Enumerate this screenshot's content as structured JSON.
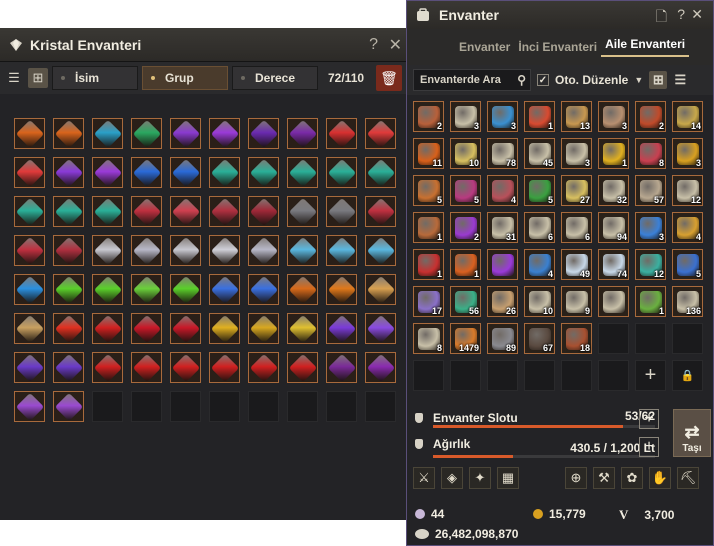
{
  "kristal": {
    "title": "Kristal Envanteri",
    "help": "?",
    "close": "✕",
    "sort_name": "İsim",
    "sort_group": "Grup",
    "sort_grade": "Derece",
    "count": "72/110",
    "trash": "🗑",
    "view_list": "☰",
    "view_grid": "⊞",
    "filled": 72,
    "total": 80,
    "gem_colors": [
      "#d9641c",
      "#d9641c",
      "#2aa0c8",
      "#2aa860",
      "#8a3ad0",
      "#9a3ad8",
      "#6a2ab0",
      "#7a2aa8",
      "#d83030",
      "#e03a3a",
      "#e03a3a",
      "#8a3ad8",
      "#9a3ad8",
      "#2a6ad8",
      "#2a6ad8",
      "#2ab098",
      "#2ab098",
      "#2ab098",
      "#2ab098",
      "#2ab098",
      "#2ab098",
      "#2ab098",
      "#2ab098",
      "#c03040",
      "#d04050",
      "#b03040",
      "#a02838",
      "#7a7a80",
      "#7a7a80",
      "#c03040",
      "#c03040",
      "#b03040",
      "#c8c8d0",
      "#b8b8c8",
      "#c8c8d0",
      "#d0d0d8",
      "#b8b8c8",
      "#5ab8e0",
      "#5ab8e0",
      "#5ab8e0",
      "#2a90e0",
      "#5ad02a",
      "#5ad02a",
      "#6ad03a",
      "#5ad02a",
      "#3a70e0",
      "#3a70e0",
      "#d86a1a",
      "#e0781a",
      "#d8a050",
      "#c8a060",
      "#e03020",
      "#d02020",
      "#c81828",
      "#c81828",
      "#e0b020",
      "#d8a820",
      "#e0c030",
      "#7a3ad8",
      "#8a4ae0",
      "#6a3ac8",
      "#6a3ac8",
      "#d02020",
      "#d02020",
      "#d02020",
      "#d02020",
      "#d02020",
      "#d02020",
      "#7a2a98",
      "#8a2ab0",
      "#9a4ad0",
      "#9a4ad0"
    ]
  },
  "envanter": {
    "title": "Envanter",
    "tabs": [
      "Envanter",
      "İnci Envanteri",
      "Aile Envanteri"
    ],
    "active_tab": "Aile Envanteri",
    "search_label": "Envanterde Ara",
    "auto_sort": "Oto. Düzenle",
    "items": [
      {
        "c": "#b8603a",
        "q": "2"
      },
      {
        "c": "#c8c0a8",
        "q": "3"
      },
      {
        "c": "#3a90d0",
        "q": "3"
      },
      {
        "c": "#d84a30",
        "q": "1"
      },
      {
        "c": "#c89850",
        "q": "13"
      },
      {
        "c": "#b89070",
        "q": "3"
      },
      {
        "c": "#c04a2a",
        "q": "2"
      },
      {
        "c": "#c8a84a",
        "q": "14"
      },
      {
        "c": "#d8601a",
        "q": "11"
      },
      {
        "c": "#d8c060",
        "q": "10"
      },
      {
        "c": "#c8c0a8",
        "q": "78"
      },
      {
        "c": "#c8c0a8",
        "q": "45"
      },
      {
        "c": "#c8c0a8",
        "q": "3"
      },
      {
        "c": "#e0b020",
        "q": "1"
      },
      {
        "c": "#c84050",
        "q": "8"
      },
      {
        "c": "#d8a020",
        "q": "3"
      },
      {
        "c": "#c87030",
        "q": "5"
      },
      {
        "c": "#b83a80",
        "q": "5"
      },
      {
        "c": "#b8505a",
        "q": "4"
      },
      {
        "c": "#3aa040",
        "q": "5"
      },
      {
        "c": "#d8c060",
        "q": "27"
      },
      {
        "c": "#c8c0a8",
        "q": "32"
      },
      {
        "c": "#b8a890",
        "q": "57"
      },
      {
        "c": "#c8c0a8",
        "q": "12"
      },
      {
        "c": "#b86a3a",
        "q": "1"
      },
      {
        "c": "#9a3ad0",
        "q": "2"
      },
      {
        "c": "#c8c0a8",
        "q": "31"
      },
      {
        "c": "#c8c0a8",
        "q": "6"
      },
      {
        "c": "#c8c0a8",
        "q": "6"
      },
      {
        "c": "#c8c0a8",
        "q": "94"
      },
      {
        "c": "#3a80d8",
        "q": "3"
      },
      {
        "c": "#d8a030",
        "q": "4"
      },
      {
        "c": "#c83030",
        "q": "1"
      },
      {
        "c": "#d86020",
        "q": "1"
      },
      {
        "c": "#9a3ad8",
        "q": ""
      },
      {
        "c": "#3a80d0",
        "q": "4"
      },
      {
        "c": "#c8d8e8",
        "q": "49"
      },
      {
        "c": "#c8d8e8",
        "q": "74"
      },
      {
        "c": "#3ab0a0",
        "q": "12"
      },
      {
        "c": "#3a70d0",
        "q": "5"
      },
      {
        "c": "#8a70c8",
        "q": "17"
      },
      {
        "c": "#3ab088",
        "q": "56"
      },
      {
        "c": "#c8a070",
        "q": "26"
      },
      {
        "c": "#c8c0a8",
        "q": "10"
      },
      {
        "c": "#c8c0a8",
        "q": "9"
      },
      {
        "c": "#c8c0a8",
        "q": ""
      },
      {
        "c": "#6ab040",
        "q": "1"
      },
      {
        "c": "#c8c0a8",
        "q": "136"
      },
      {
        "c": "#c8c0a8",
        "q": "8"
      },
      {
        "c": "#d87a2a",
        "q": "1479"
      },
      {
        "c": "#8a8a90",
        "q": "89"
      },
      {
        "c": "#5a4a40",
        "q": "67"
      },
      {
        "c": "#a85030",
        "q": "18"
      }
    ],
    "plus": "+",
    "lock": "🔒",
    "slot_label": "Envanter Slotu",
    "slot_value": "53/62",
    "slot_ratio": 0.855,
    "weight_label": "Ağırlık",
    "weight_value": "430.5 / 1,200 Lt",
    "weight_ratio": 0.359,
    "move_label": "Taşı",
    "pearls": "44",
    "loyalty": "15,779",
    "energy_symbol": "V",
    "energy": "3,700",
    "silver": "26,482,098,870"
  }
}
